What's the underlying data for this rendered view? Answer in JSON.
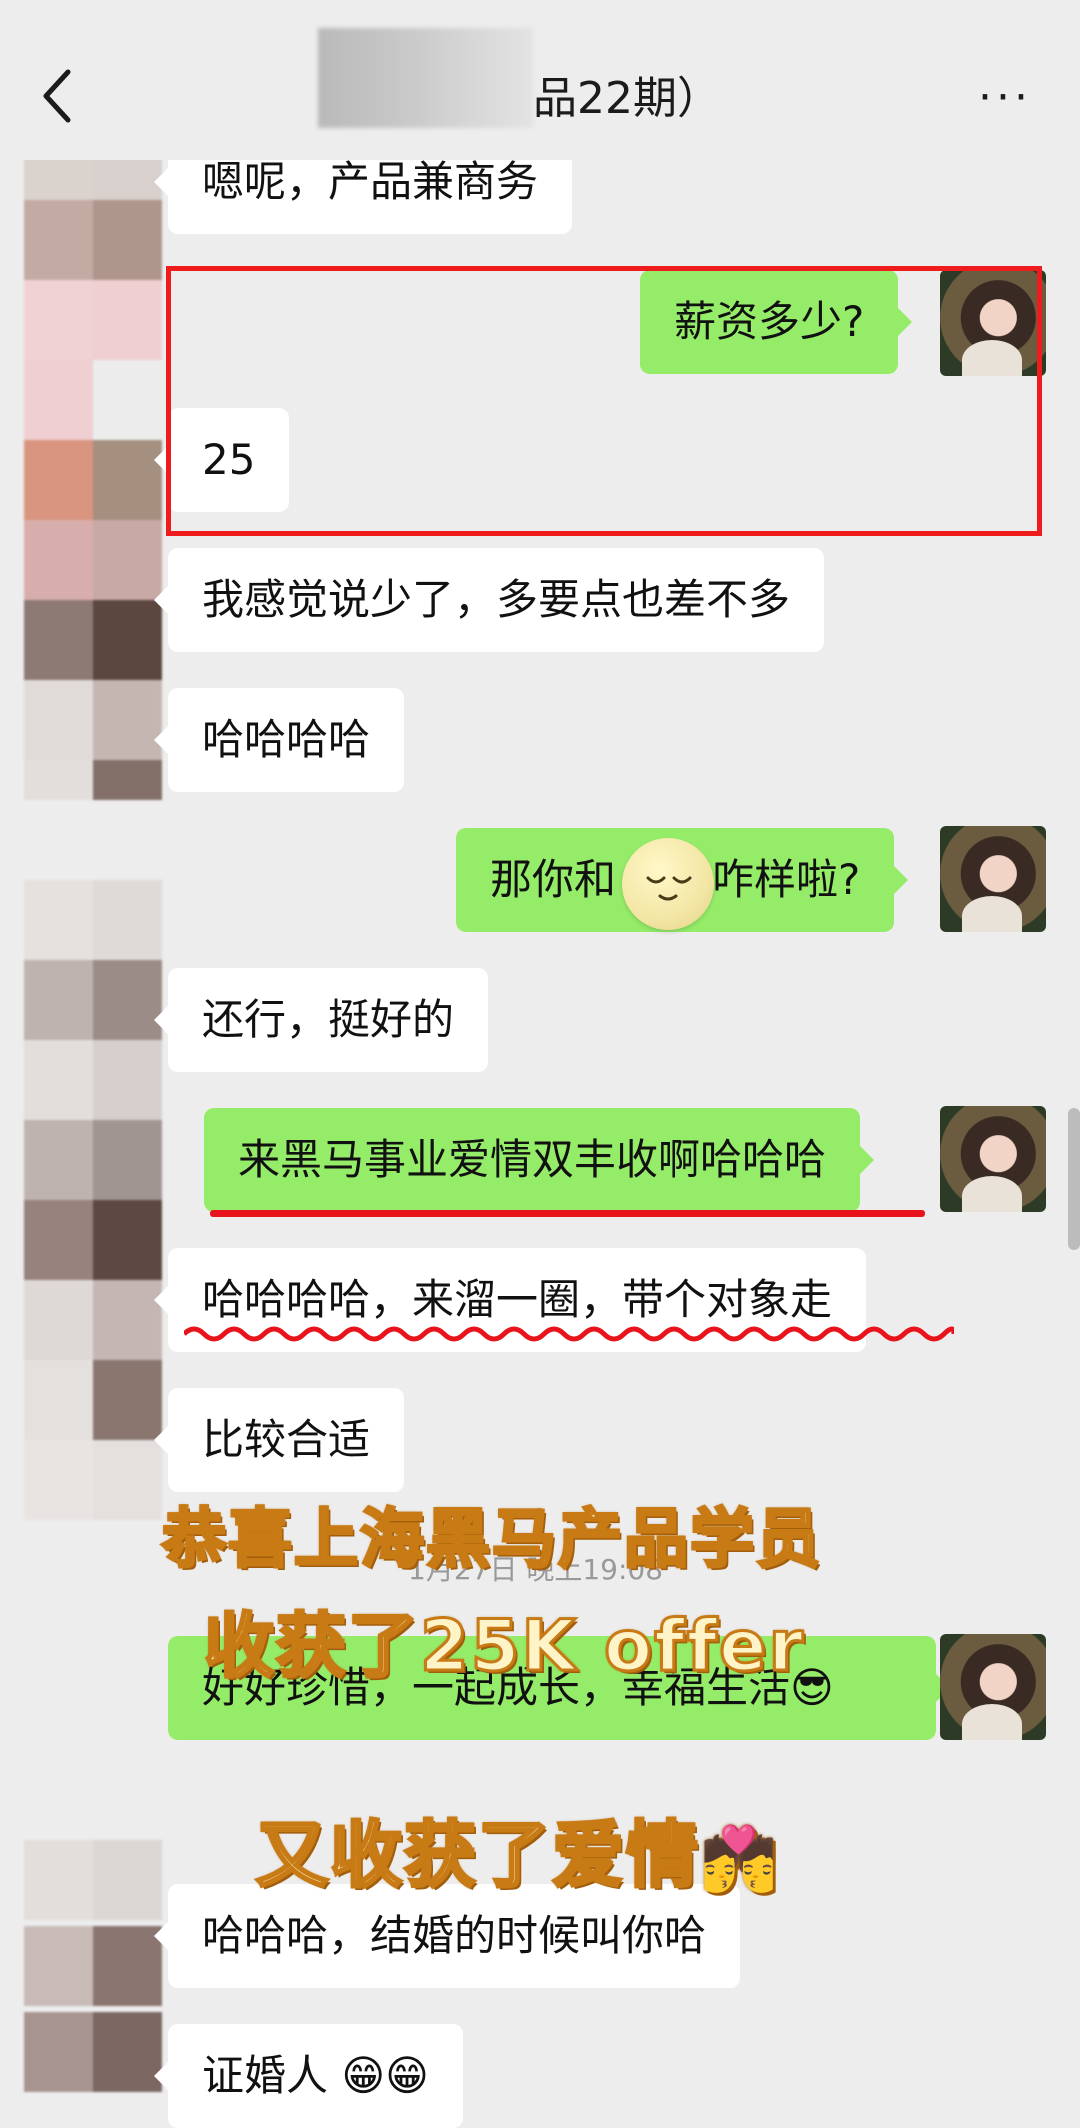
{
  "header": {
    "title_visible": "品22期）",
    "more_label": "···"
  },
  "messages": [
    {
      "side": "in",
      "text": "嗯呢，产品兼商务"
    },
    {
      "side": "out",
      "text": "薪资多少?"
    },
    {
      "side": "in",
      "text": "25"
    },
    {
      "side": "in",
      "text": "我感觉说少了，多要点也差不多"
    },
    {
      "side": "in",
      "text": "哈哈哈哈"
    },
    {
      "side": "out",
      "text_before": "那你和",
      "text_after": "咋样啦?"
    },
    {
      "side": "in",
      "text": "还行，挺好的"
    },
    {
      "side": "out",
      "text": "来黑马事业爱情双丰收啊哈哈哈"
    },
    {
      "side": "in",
      "text": "哈哈哈哈，来溜一圈，带个对象走"
    },
    {
      "side": "in",
      "text": "比较合适"
    },
    {
      "side": "out",
      "text": "好好珍惜，一起成长，幸福生活😎"
    },
    {
      "side": "in",
      "text": "哈哈哈，结婚的时候叫你哈"
    },
    {
      "side": "in",
      "text": "证婚人 😁😁"
    }
  ],
  "timestamp": "1月27日 晚上19:08",
  "overlay": {
    "line1": "恭喜上海黑马产品学员",
    "line2": "收获了25K offer",
    "line3": "又收获了爱情",
    "line3_emoji": "💏"
  },
  "colors": {
    "background": "#ededed",
    "outgoing": "#95ec69",
    "incoming": "#ffffff",
    "highlight": "#ee1c1c"
  }
}
